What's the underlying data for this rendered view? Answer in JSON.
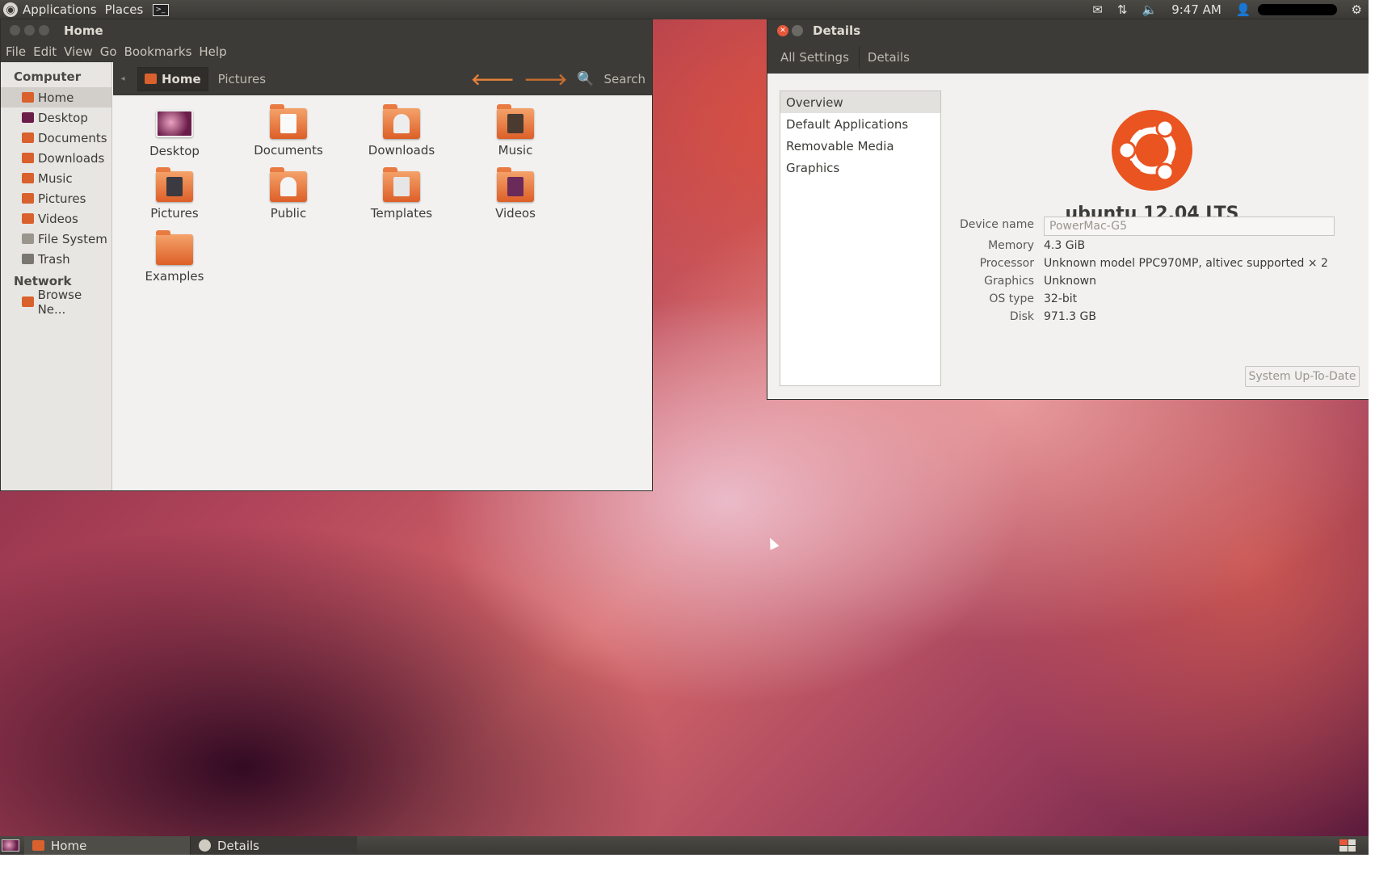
{
  "top_panel": {
    "menus": [
      "Applications",
      "Places"
    ],
    "time": "9:47 AM",
    "icons": [
      "ubuntu-logo-icon",
      "terminal-icon",
      "mail-icon",
      "network-icon",
      "volume-icon",
      "user-icon",
      "gear-icon"
    ]
  },
  "nautilus": {
    "title": "Home",
    "menubar": [
      "File",
      "Edit",
      "View",
      "Go",
      "Bookmarks",
      "Help"
    ],
    "breadcrumb": {
      "current": "Home",
      "next": "Pictures"
    },
    "search_label": "Search",
    "sidebar": {
      "computer_header": "Computer",
      "computer_items": [
        "Home",
        "Desktop",
        "Documents",
        "Downloads",
        "Music",
        "Pictures",
        "Videos",
        "File System",
        "Trash"
      ],
      "network_header": "Network",
      "network_items": [
        "Browse Ne..."
      ]
    },
    "files": [
      "Desktop",
      "Documents",
      "Downloads",
      "Music",
      "Pictures",
      "Public",
      "Templates",
      "Videos",
      "Examples"
    ]
  },
  "details": {
    "title": "Details",
    "crumbs": [
      "All Settings",
      "Details"
    ],
    "list": [
      "Overview",
      "Default Applications",
      "Removable Media",
      "Graphics"
    ],
    "os_name": "ubuntu 12.04 LTS",
    "device_name_label": "Device name",
    "device_name_value": "PowerMac-G5",
    "rows": [
      {
        "label": "Memory",
        "value": "4.3 GiB"
      },
      {
        "label": "Processor",
        "value": "Unknown model PPC970MP, altivec supported × 2"
      },
      {
        "label": "Graphics",
        "value": "Unknown"
      },
      {
        "label": "OS type",
        "value": "32-bit"
      },
      {
        "label": "Disk",
        "value": "971.3 GB"
      }
    ],
    "update_button": "System Up-To-Date",
    "brand_color": "#e95420"
  },
  "taskbar": {
    "tasks": [
      "Home",
      "Details"
    ]
  }
}
